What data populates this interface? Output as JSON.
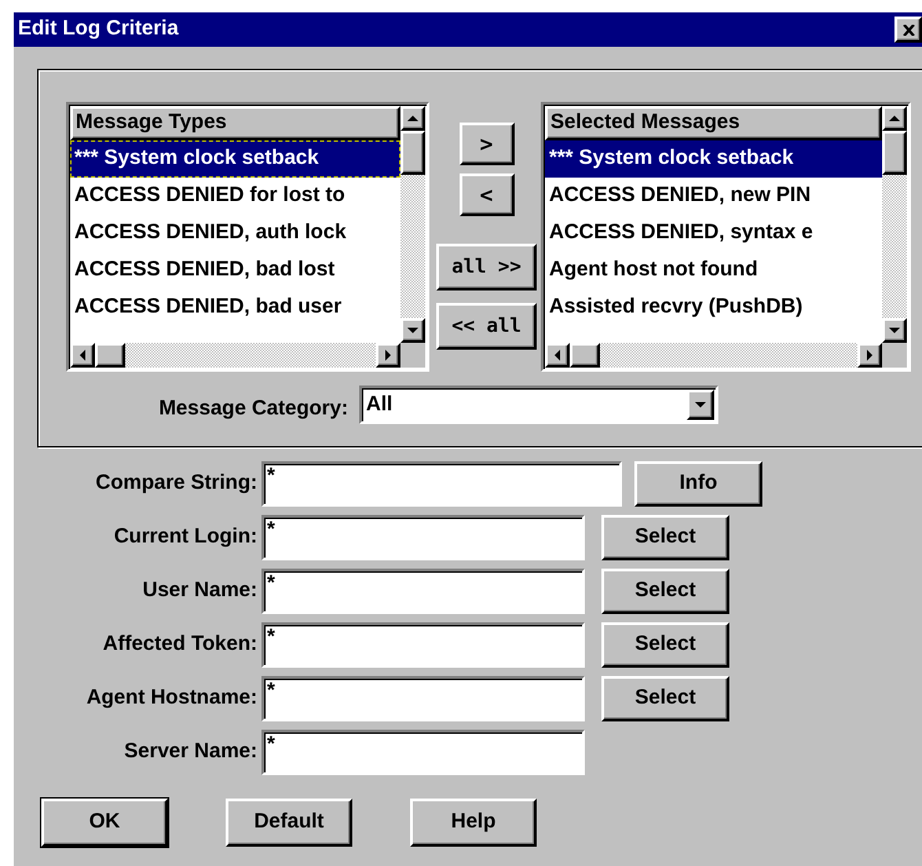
{
  "window": {
    "title": "Edit Log Criteria"
  },
  "lists": [
    {
      "header": "Message Types",
      "items": [
        {
          "text": "*** System clock setback",
          "selected": true,
          "focused": true
        },
        {
          "text": "ACCESS DENIED for lost to",
          "selected": false,
          "focused": false
        },
        {
          "text": "ACCESS DENIED, auth lock",
          "selected": false,
          "focused": false
        },
        {
          "text": "ACCESS DENIED, bad lost",
          "selected": false,
          "focused": false
        },
        {
          "text": "ACCESS DENIED, bad user",
          "selected": false,
          "focused": false
        }
      ]
    },
    {
      "header": "Selected Messages",
      "items": [
        {
          "text": "*** System clock setback",
          "selected": true,
          "focused": false
        },
        {
          "text": "ACCESS DENIED, new PIN",
          "selected": false,
          "focused": false
        },
        {
          "text": "ACCESS DENIED, syntax e",
          "selected": false,
          "focused": false
        },
        {
          "text": "Agent host not found",
          "selected": false,
          "focused": false
        },
        {
          "text": "Assisted recvry (PushDB)",
          "selected": false,
          "focused": false
        }
      ]
    }
  ],
  "move_buttons": [
    {
      "label": ">",
      "kind": "small"
    },
    {
      "label": "<",
      "kind": "small"
    },
    {
      "label": "all >>",
      "kind": "wide"
    },
    {
      "label": "<< all",
      "kind": "wide"
    }
  ],
  "category": {
    "label": "Message Category:",
    "value": "All"
  },
  "fields": [
    {
      "label": "Compare String:",
      "value": "*",
      "button": "Info",
      "kind": "wide"
    },
    {
      "label": "Current Login:",
      "value": "*",
      "button": "Select",
      "kind": "normal"
    },
    {
      "label": "User Name:",
      "value": "*",
      "button": "Select",
      "kind": "normal"
    },
    {
      "label": "Affected Token:",
      "value": "*",
      "button": "Select",
      "kind": "normal"
    },
    {
      "label": "Agent Hostname:",
      "value": "*",
      "button": "Select",
      "kind": "normal"
    },
    {
      "label": "Server Name:",
      "value": "*",
      "kind": "normal"
    }
  ],
  "buttons": [
    {
      "label": "OK",
      "default": true
    },
    {
      "label": "Default",
      "default": false
    },
    {
      "label": "Help",
      "default": false
    }
  ]
}
